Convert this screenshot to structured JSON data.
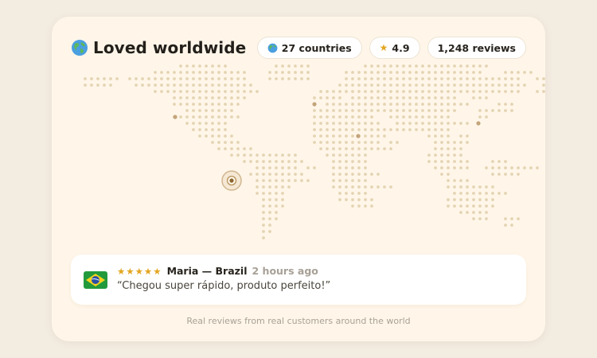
{
  "header": {
    "title": "Loved worldwide",
    "title_icon": "globe-icon"
  },
  "stats": {
    "countries": "27 countries",
    "rating": "4.9",
    "reviews": "1,248 reviews"
  },
  "map": {
    "dot_color": "#e4d4b3",
    "marker_color": "#c4a47b",
    "highlight_marker": "brazil-location-marker",
    "markers": [
      "north-america",
      "europe",
      "middle-east",
      "east-asia",
      "south-america"
    ]
  },
  "review": {
    "stars": "★★★★★",
    "reviewer": "Maria — Brazil",
    "time": "2 hours ago",
    "text": "“Chegou super rápido, produto perfeito!”",
    "flag_icon": "brazil-flag-icon"
  },
  "footer": {
    "text": "Real reviews from real customers around the world"
  },
  "colors": {
    "background": "#f3ece1",
    "card": "#fff6e9",
    "star": "#e3a620"
  }
}
